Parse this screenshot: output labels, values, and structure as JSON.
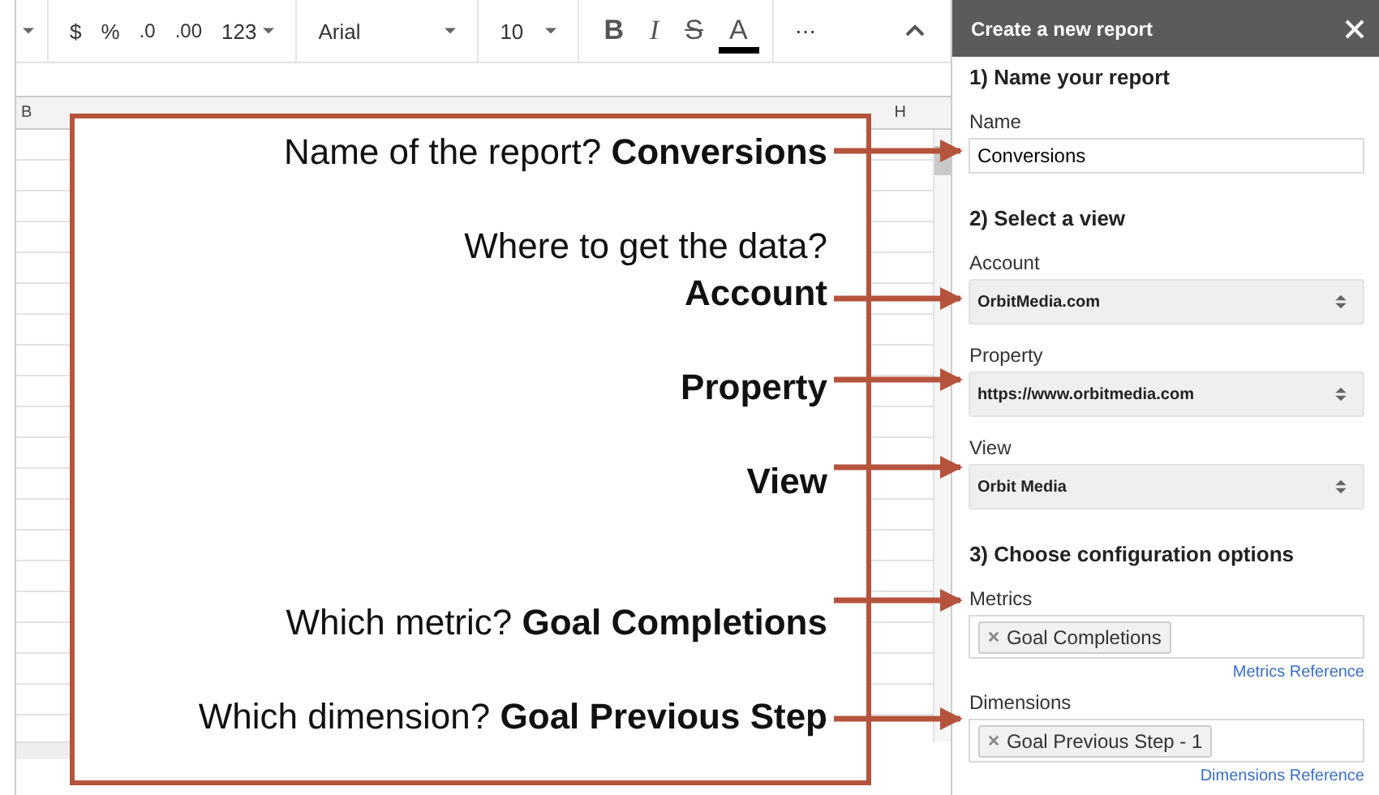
{
  "toolbar": {
    "currency": "$",
    "percent": "%",
    "decrease_decimals": ".0",
    "increase_decimals": ".00",
    "number_format": "123",
    "font": "Arial",
    "font_size": "10",
    "bold": "B",
    "italic": "I",
    "strikethrough": "S",
    "text_color": "A",
    "more": "⋯"
  },
  "column_headers": [
    {
      "label": "B"
    },
    {
      "label": "H"
    }
  ],
  "callout": {
    "lines": [
      "Name of the report? **Conversions**",
      "Where to get the data?",
      "**Account**",
      "**Property**",
      "**View**",
      "Which metric? **Goal Completions**",
      "Which dimension? **Goal Previous Step**"
    ]
  },
  "sidebar": {
    "title": "Create a new report",
    "sections": [
      {
        "heading": "1) Name your report",
        "fields": [
          {
            "kind": "text",
            "label": "Name",
            "value": "Conversions"
          }
        ]
      },
      {
        "heading": "2) Select a view",
        "fields": [
          {
            "kind": "select",
            "label": "Account",
            "value": "OrbitMedia.com"
          },
          {
            "kind": "select",
            "label": "Property",
            "value": "https://www.orbitmedia.com"
          },
          {
            "kind": "select",
            "label": "View",
            "value": "Orbit Media"
          }
        ]
      },
      {
        "heading": "3) Choose configuration options",
        "fields": [
          {
            "kind": "chips",
            "label": "Metrics",
            "chips": [
              "Goal Completions"
            ],
            "link": "Metrics Reference"
          },
          {
            "kind": "chips",
            "label": "Dimensions",
            "chips": [
              "Goal Previous Step - 1"
            ],
            "link": "Dimensions Reference"
          }
        ]
      }
    ]
  }
}
